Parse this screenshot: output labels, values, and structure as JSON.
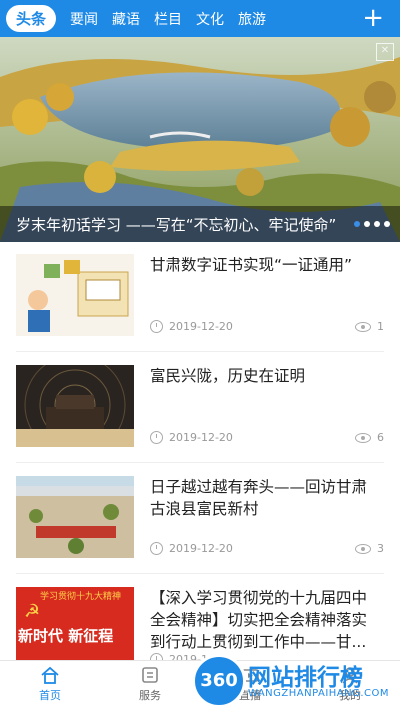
{
  "topbar": {
    "tabs": [
      {
        "label": "头条",
        "active": true
      },
      {
        "label": "要闻"
      },
      {
        "label": "藏语"
      },
      {
        "label": "栏目"
      },
      {
        "label": "文化"
      },
      {
        "label": "旅游"
      }
    ],
    "add_icon": "plus-icon"
  },
  "hero": {
    "caption": "岁末年初话学习 ——写在“不忘初心、牢记使命”",
    "slide_count": 4,
    "current_slide": 1
  },
  "news": [
    {
      "title": "甘肃数字证书实现“一证通用”",
      "date": "2019-12-20",
      "views": "1"
    },
    {
      "title": "富民兴陇，历史在证明",
      "date": "2019-12-20",
      "views": "6"
    },
    {
      "title": "日子越过越有奔头——回访甘肃古浪县富民新村",
      "date": "2019-12-20",
      "views": "3"
    },
    {
      "title": "【深入学习贯彻党的十九届四中全会精神】切实把全会精神落实到行动上贯彻到工作中——甘...",
      "date": "2019-1",
      "views": ""
    }
  ],
  "thumb4": {
    "top_text": "学习贯彻十九大精神",
    "bottom_text": "新时代 新征程"
  },
  "bottomnav": [
    {
      "label": "首页",
      "icon": "home-icon",
      "active": true
    },
    {
      "label": "服务",
      "icon": "service-icon"
    },
    {
      "label": "直播",
      "icon": "live-icon"
    },
    {
      "label": "我的",
      "icon": "user-icon"
    }
  ],
  "watermark": {
    "badge": "360",
    "title": "网站排行榜",
    "subtitle": "WANGZHANPAIHANG.COM"
  },
  "colors": {
    "brand_blue": "#1f8ae6",
    "date_gray": "#999999"
  }
}
